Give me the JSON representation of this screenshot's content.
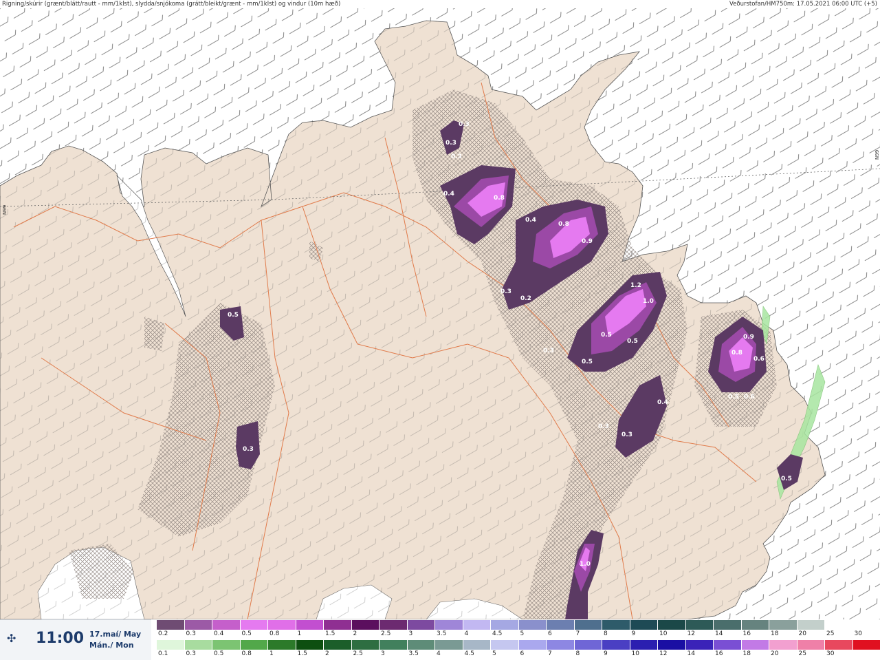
{
  "header": {
    "title": "Rigning/skúrir (grænt/blátt/rautt - mm/1klst), slydda/snjókoma (grátt/bleikt/grænt - mm/1klst) og vindur (10m hæð)",
    "source": "Veðurstofan/HM750m: 17.05.2021 06:00 UTC (+5)"
  },
  "map": {
    "parallel_label": "N99",
    "colors": {
      "land": "#efe1d3",
      "sea": "#ffffff",
      "roads": "#e07a4a",
      "precip_dark": "#5b3a63",
      "precip_mid": "#9b49a6",
      "precip_light": "#e57af0",
      "rain_green": "#a8e6a0"
    },
    "precip_labels": [
      {
        "text": "0.3"
      },
      {
        "text": "0.3"
      },
      {
        "text": "0.3"
      },
      {
        "text": "0.4"
      },
      {
        "text": "0.8"
      },
      {
        "text": "0.4"
      },
      {
        "text": "0.8"
      },
      {
        "text": "0.9"
      },
      {
        "text": "0.3"
      },
      {
        "text": "0.2"
      },
      {
        "text": "1.2"
      },
      {
        "text": "1.0"
      },
      {
        "text": "0.5"
      },
      {
        "text": "0.5"
      },
      {
        "text": "0.3"
      },
      {
        "text": "0.5"
      },
      {
        "text": "0.4"
      },
      {
        "text": "0.3"
      },
      {
        "text": "0.3"
      },
      {
        "text": "0.5"
      },
      {
        "text": "0.3"
      },
      {
        "text": "0.9"
      },
      {
        "text": "0.8"
      },
      {
        "text": "0.6"
      },
      {
        "text": "0.5"
      },
      {
        "text": "0.6"
      },
      {
        "text": "0.5"
      },
      {
        "text": "1.0"
      }
    ]
  },
  "footer": {
    "logo_icon": "vedur-logo-icon",
    "time": "11:00",
    "date_line1": "17.maí/ May",
    "date_line2": "Mán./ Mon"
  },
  "legend": {
    "snow_colors": [
      "#6f4c73",
      "#9c5aa6",
      "#c55fcb",
      "#e57af0",
      "#e06fe8",
      "#c24fd0",
      "#8f2f92",
      "#5b0f5e",
      "#6c2a70",
      "#7d4aa0",
      "#9f86d8",
      "#c2b8f2",
      "#a5a8e3",
      "#8a90cc",
      "#6c7fb0",
      "#4f6f8e",
      "#2e5b6a",
      "#1e4a55",
      "#1b4848",
      "#2d5a57",
      "#4a6e6c",
      "#66837f",
      "#8aa09c",
      "#c3cfcb",
      "#ffffff"
    ],
    "snow_labels": [
      "0.2",
      "0.3",
      "0.4",
      "0.5",
      "0.8",
      "1",
      "1.5",
      "2",
      "2.5",
      "3",
      "3.5",
      "4",
      "4.5",
      "5",
      "6",
      "7",
      "8",
      "9",
      "10",
      "12",
      "14",
      "16",
      "18",
      "20",
      "25",
      "30"
    ],
    "rain_colors": [
      "#dff6db",
      "#a8dc9f",
      "#7cc472",
      "#52a84a",
      "#2c7a2a",
      "#0d4f10",
      "#1b5e2a",
      "#2e6e41",
      "#41805d",
      "#5e8c78",
      "#7a9a94",
      "#a7b7c7",
      "#c5c7f0",
      "#aaa8ee",
      "#8d87e3",
      "#6f66d6",
      "#4a3fc3",
      "#2b1fb0",
      "#1a0fa3",
      "#3a23b8",
      "#7a4fd4",
      "#c27ae6",
      "#f2a0d0",
      "#ef80a8",
      "#e8485e",
      "#e01020"
    ],
    "rain_labels": [
      "0.1",
      "0.3",
      "0.5",
      "0.8",
      "1",
      "1.5",
      "2",
      "2.5",
      "3",
      "3.5",
      "4",
      "4.5",
      "5",
      "6",
      "7",
      "8",
      "9",
      "10",
      "12",
      "14",
      "16",
      "18",
      "20",
      "25",
      "30"
    ]
  }
}
